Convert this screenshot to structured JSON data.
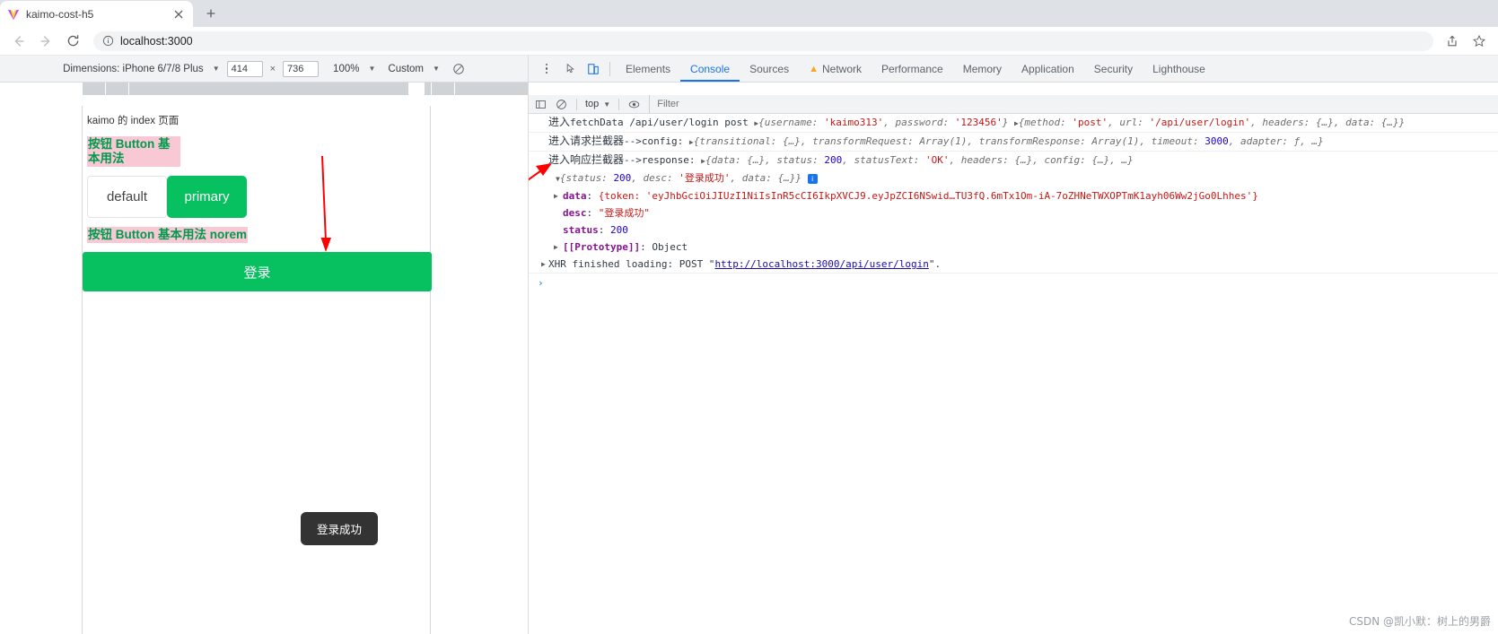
{
  "browser": {
    "tab": {
      "title": "kaimo-cost-h5",
      "favicon": "vite-logo-icon",
      "close": "close-icon"
    },
    "new_tab_label": "+",
    "nav": {
      "back": "back-arrow-icon",
      "forward": "forward-arrow-icon",
      "reload": "reload-icon"
    },
    "omnibox": {
      "info_icon": "info-circle-icon",
      "url": "localhost:3000"
    },
    "toolbar_right": {
      "share": "share-icon",
      "bookmark": "star-icon"
    }
  },
  "device_toolbar": {
    "dimensions_label": "Dimensions: iPhone 6/7/8 Plus",
    "width": "414",
    "x": "×",
    "height": "736",
    "zoom": "100%",
    "throttling": "Custom",
    "rotate_icon": "rotate-device-icon"
  },
  "devtools": {
    "inspect_icon": "inspect-element-icon",
    "device_toggle_icon": "device-toolbar-icon",
    "tabs": [
      {
        "label": "Elements",
        "active": false,
        "warn": false
      },
      {
        "label": "Console",
        "active": true,
        "warn": false
      },
      {
        "label": "Sources",
        "active": false,
        "warn": false
      },
      {
        "label": "Network",
        "active": false,
        "warn": true
      },
      {
        "label": "Performance",
        "active": false,
        "warn": false
      },
      {
        "label": "Memory",
        "active": false,
        "warn": false
      },
      {
        "label": "Application",
        "active": false,
        "warn": false
      },
      {
        "label": "Security",
        "active": false,
        "warn": false
      },
      {
        "label": "Lighthouse",
        "active": false,
        "warn": false
      }
    ],
    "kebab": "more-options-icon"
  },
  "console_filter_bar": {
    "sidebar_icon": "console-sidebar-icon",
    "clear_icon": "clear-console-icon",
    "context": "top",
    "eye_icon": "live-expression-icon",
    "filter_placeholder": "Filter",
    "filter_value": ""
  },
  "console": {
    "lines": [
      {
        "id": "line-fetchdata",
        "parts": [
          {
            "t": "进入",
            "s": "cjk"
          },
          {
            "t": "fetchData /api/user/login post ",
            "s": "plain"
          },
          {
            "t": "▶",
            "s": "tri"
          },
          {
            "t": "{username: ",
            "s": "italic"
          },
          {
            "t": "'kaimo313'",
            "s": "str"
          },
          {
            "t": ", password: ",
            "s": "italic"
          },
          {
            "t": "'123456'",
            "s": "str"
          },
          {
            "t": "} ",
            "s": "italic"
          },
          {
            "t": "▶",
            "s": "tri"
          },
          {
            "t": "{method: ",
            "s": "italic"
          },
          {
            "t": "'post'",
            "s": "str"
          },
          {
            "t": ", url: ",
            "s": "italic"
          },
          {
            "t": "'/api/user/login'",
            "s": "str"
          },
          {
            "t": ", headers: {…}, data: {…}}",
            "s": "italic"
          }
        ]
      },
      {
        "id": "line-request-interceptor",
        "parts": [
          {
            "t": "进入请求拦截器",
            "s": "cjk"
          },
          {
            "t": "-->config:  ",
            "s": "plain"
          },
          {
            "t": "▶",
            "s": "tri"
          },
          {
            "t": "{transitional: {…}, transformRequest: Array(1), transformResponse: Array(1), timeout: ",
            "s": "italic"
          },
          {
            "t": "3000",
            "s": "num"
          },
          {
            "t": ", adapter: ƒ, …}",
            "s": "italic"
          }
        ]
      },
      {
        "id": "line-response-interceptor",
        "parts": [
          {
            "t": "进入响应拦截器",
            "s": "cjk"
          },
          {
            "t": "-->response:  ",
            "s": "plain"
          },
          {
            "t": "▶",
            "s": "tri"
          },
          {
            "t": "{data: {…}, status: ",
            "s": "italic"
          },
          {
            "t": "200",
            "s": "num"
          },
          {
            "t": ", statusText: ",
            "s": "italic"
          },
          {
            "t": "'OK'",
            "s": "str"
          },
          {
            "t": ", headers: {…}, config: {…}, …}",
            "s": "italic"
          }
        ]
      }
    ],
    "expanded_object": {
      "header_parts": [
        {
          "t": "▼",
          "s": "tri"
        },
        {
          "t": "{status: ",
          "s": "italic"
        },
        {
          "t": "200",
          "s": "num"
        },
        {
          "t": ", desc: ",
          "s": "italic"
        },
        {
          "t": "'登录成功'",
          "s": "str"
        },
        {
          "t": ", data: {…}}",
          "s": "italic"
        }
      ],
      "info_badge": "i",
      "props": [
        {
          "id": "prop-data",
          "arrow": "▶",
          "key": "data",
          "sep": ": ",
          "value": "{token: 'eyJhbGciOiJIUzI1NiIsInR5cCI6IkpXVCJ9.eyJpZCI6NSwid…TU3fQ.6mTx1Om-iA-7oZHNeTWXOPTmK1ayh06Ww2jGo0Lhhes'}",
          "value_style": "str"
        },
        {
          "id": "prop-desc",
          "arrow": "",
          "key": "desc",
          "sep": ": ",
          "value": "\"登录成功\"",
          "value_style": "str"
        },
        {
          "id": "prop-status",
          "arrow": "",
          "key": "status",
          "sep": ": ",
          "value": "200",
          "value_style": "num"
        },
        {
          "id": "prop-prototype",
          "arrow": "▶",
          "key": "[[Prototype]]",
          "sep": ": ",
          "value": "Object",
          "value_style": "plain"
        }
      ]
    },
    "xhr_line": {
      "arrow": "▶",
      "prefix": "XHR finished loading: POST \"",
      "url": "http://localhost:3000/api/user/login",
      "suffix": "\"."
    },
    "prompt": "›"
  },
  "page": {
    "index_title": "kaimo 的 index 页面",
    "heading1": "按钮 Button 基本用法",
    "btn_default": "default",
    "btn_primary": "primary",
    "heading2": "按钮 Button 基本用法 norem",
    "btn_login": "登录",
    "toast": "登录成功"
  },
  "annotations": {
    "arrow1": "red-arrow-down",
    "arrow2": "red-arrow-to-console"
  },
  "watermark": "CSDN @凯小默：树上的男爵",
  "colors": {
    "accent_green": "#07c160",
    "highlight_pink": "#f8c8d4",
    "heading_green": "#00994d",
    "devtools_blue": "#1a73e8",
    "annotation_red": "#ff0000",
    "toast_bg": "#333333"
  }
}
